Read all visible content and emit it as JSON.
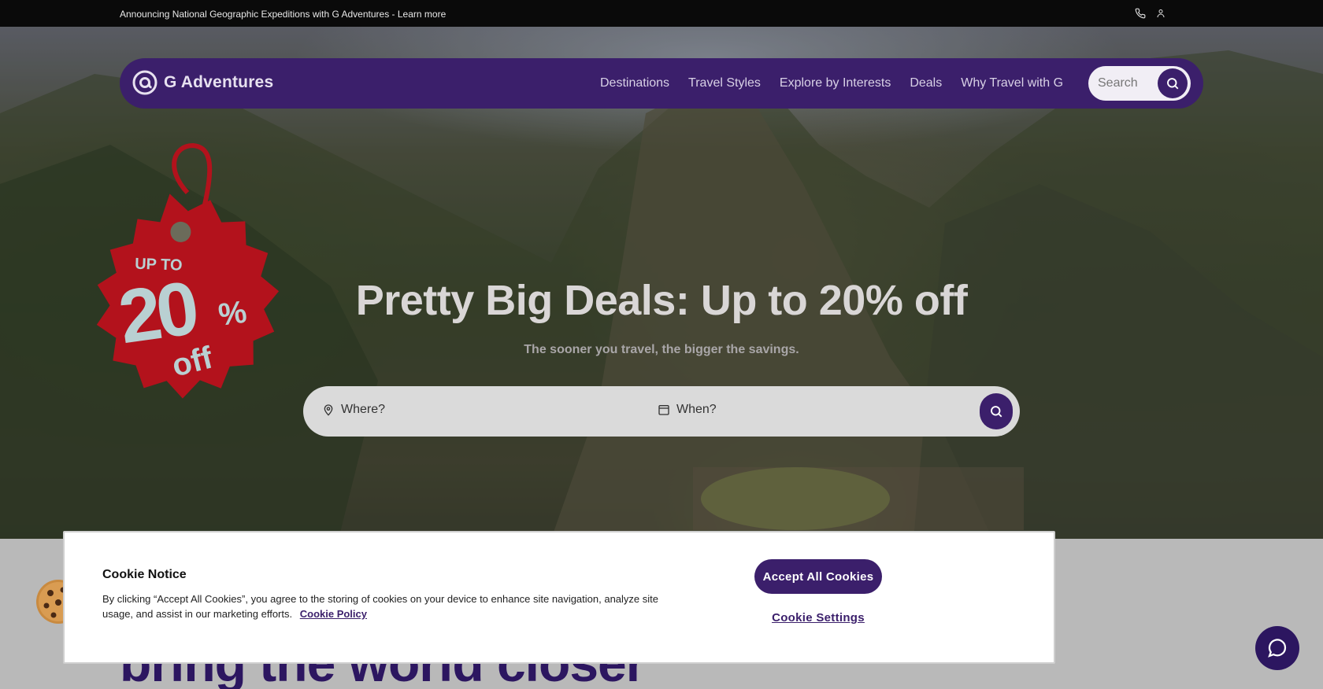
{
  "announcement": {
    "text": "Announcing National Geographic Expeditions with G Adventures - Learn more",
    "icons": [
      "phone-icon",
      "user-icon"
    ]
  },
  "nav": {
    "logo_text": "G Adventures",
    "links": [
      "Destinations",
      "Travel Styles",
      "Explore by Interests",
      "Deals",
      "Why Travel with G"
    ],
    "search_placeholder": "Search"
  },
  "badge": {
    "line1": "UP TO",
    "number": "20",
    "percent": "%",
    "line3": "off"
  },
  "hero": {
    "title": "Pretty Big Deals: Up to 20% off",
    "subtitle": "The sooner you travel, the bigger the savings."
  },
  "trip_search": {
    "where_placeholder": "Where?",
    "when_placeholder": "When?"
  },
  "below": {
    "heading": "bring the world closer"
  },
  "cookie": {
    "title": "Cookie Notice",
    "text": "By clicking “Accept All Cookies”, you agree to the storing of cookies on your device to enhance site navigation, analyze site usage, and assist in our marketing efforts.",
    "policy_link": "Cookie Policy",
    "accept_label": "Accept All Cookies",
    "settings_label": "Cookie Settings"
  },
  "colors": {
    "brand_purple": "#3b1f6b",
    "badge_red": "#b3121c",
    "announcement_bg": "#0a0a0a"
  }
}
